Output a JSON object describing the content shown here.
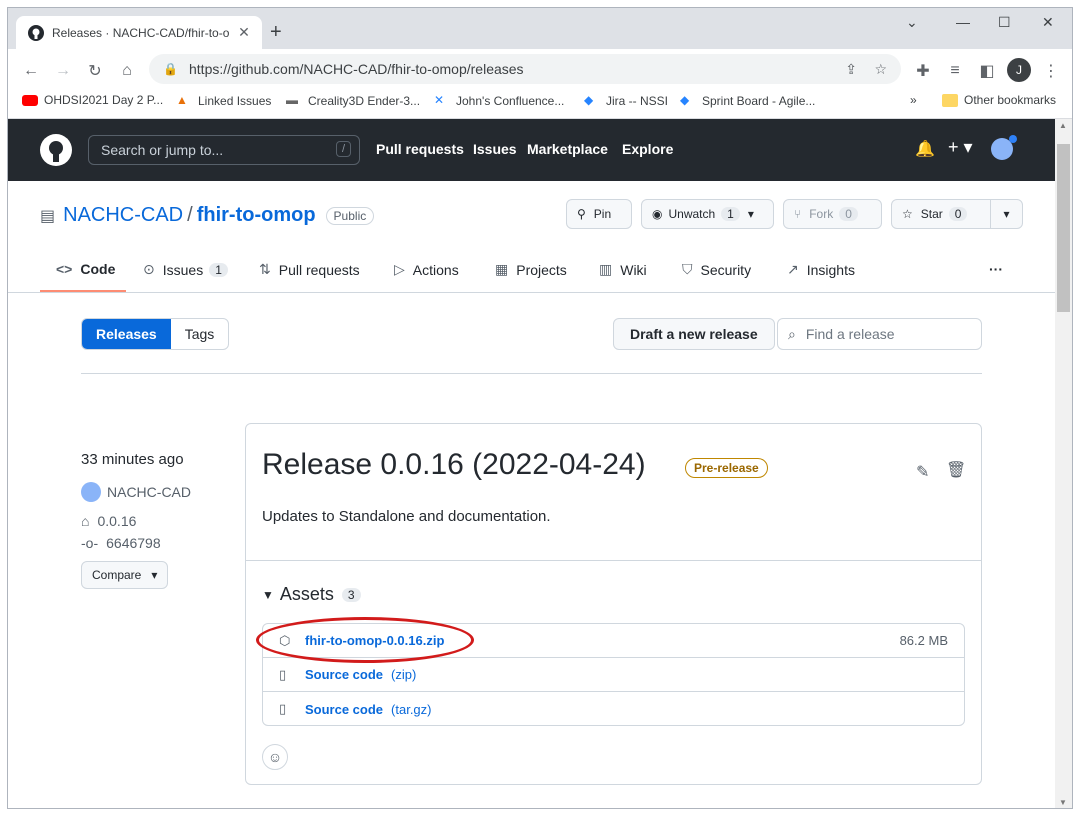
{
  "browser": {
    "tab_title": "Releases · NACHC-CAD/fhir-to-o",
    "url": "https://github.com/NACHC-CAD/fhir-to-omop/releases",
    "bookmarks": [
      "OHDSI2021 Day 2 P...",
      "Linked Issues",
      "Creality3D Ender-3...",
      "John's Confluence...",
      "Jira -- NSSI",
      "Sprint Board - Agile..."
    ],
    "more_bookmarks": "»",
    "other_bookmarks": "Other bookmarks",
    "profile_initial": "J"
  },
  "header": {
    "search_placeholder": "Search or jump to...",
    "search_shortcut": "/",
    "nav": [
      "Pull requests",
      "Issues",
      "Marketplace",
      "Explore"
    ]
  },
  "repo": {
    "owner": "NACHC-CAD",
    "separator": "/",
    "name": "fhir-to-omop",
    "visibility": "Public",
    "pin_label": "Pin",
    "unwatch_label": "Unwatch",
    "unwatch_count": "1",
    "fork_label": "Fork",
    "fork_count": "0",
    "star_label": "Star",
    "star_count": "0",
    "tabs": {
      "code": "Code",
      "issues": "Issues",
      "issues_count": "1",
      "pulls": "Pull requests",
      "actions": "Actions",
      "projects": "Projects",
      "wiki": "Wiki",
      "security": "Security",
      "insights": "Insights",
      "more": "···"
    }
  },
  "subnav": {
    "releases": "Releases",
    "tags": "Tags",
    "draft": "Draft a new release",
    "find_placeholder": "Find a release"
  },
  "release": {
    "time": "33 minutes ago",
    "author": "NACHC-CAD",
    "tag": "0.0.16",
    "commit": "6646798",
    "compare": "Compare",
    "title": "Release 0.0.16 (2022-04-24)",
    "badge": "Pre-release",
    "description": "Updates to Standalone and documentation.",
    "assets_label": "Assets",
    "assets_count": "3",
    "assets": [
      {
        "name": "fhir-to-omop-0.0.16.zip",
        "suffix": "",
        "size": "86.2 MB"
      },
      {
        "name": "Source code",
        "suffix": "(zip)",
        "size": ""
      },
      {
        "name": "Source code",
        "suffix": "(tar.gz)",
        "size": ""
      }
    ]
  }
}
